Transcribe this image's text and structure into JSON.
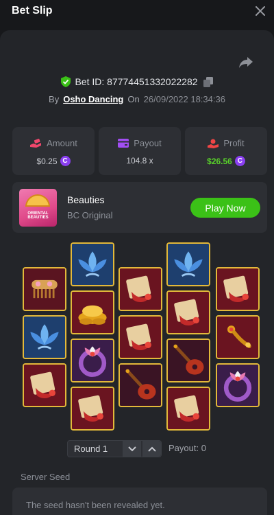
{
  "header": {
    "title": "Bet Slip"
  },
  "bet": {
    "id_label": "Bet ID: 87774451332022282",
    "by_label": "By",
    "username": "Osho Dancing",
    "on_label": "On",
    "date": "26/09/2022 18:34:36"
  },
  "stats": {
    "amount": {
      "label": "Amount",
      "value": "$0.25"
    },
    "payout": {
      "label": "Payout",
      "value": "104.8 x"
    },
    "profit": {
      "label": "Profit",
      "value": "$26.56"
    },
    "coin_symbol": "C"
  },
  "game": {
    "name": "Beauties",
    "provider": "BC Original",
    "play_label": "Play Now",
    "thumb_text": "ORIENTAL BEAUTIES"
  },
  "reels": [
    [
      "comb",
      "lotus-blue",
      "book"
    ],
    [
      "lotus-blue",
      "gold-ingots",
      "ring",
      "book"
    ],
    [
      "book",
      "book",
      "guitar"
    ],
    [
      "lotus-blue",
      "book",
      "guitar",
      "book"
    ],
    [
      "book",
      "ruyi",
      "ring"
    ]
  ],
  "round": {
    "label": "Round 1",
    "payout_label": "Payout: 0"
  },
  "seed": {
    "label": "Server Seed",
    "message": "The seed hasn't been revealed yet."
  },
  "colors": {
    "accent_green": "#3bc117",
    "profit_green": "#59d22a",
    "coin_purple": "#8a3ff0",
    "tile_border": "#e3b93a"
  }
}
